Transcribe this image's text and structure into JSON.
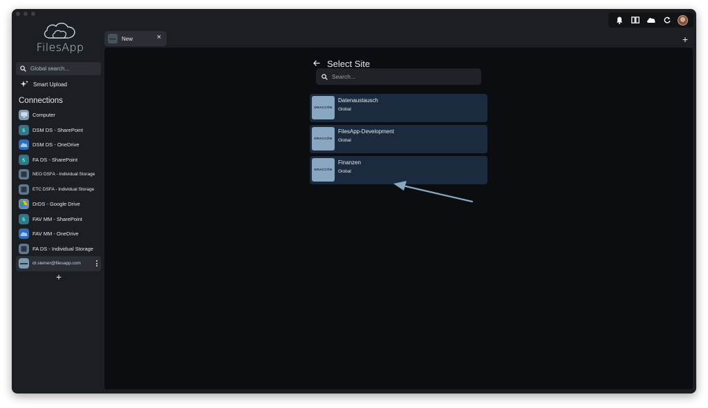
{
  "app": {
    "name": "FilesApp"
  },
  "sidebar": {
    "search_placeholder": "Global search...",
    "smart_upload_label": "Smart Upload",
    "connections_title": "Connections",
    "connections": [
      {
        "label": "Computer",
        "icon": "computer-icon"
      },
      {
        "label": "DSM DS - SharePoint",
        "icon": "sharepoint-icon"
      },
      {
        "label": "DSM DS - OneDrive",
        "icon": "onedrive-icon"
      },
      {
        "label": "FA DS - SharePoint",
        "icon": "sharepoint-icon"
      },
      {
        "label": "NEO DSFA - Individual Storage",
        "icon": "storage-icon"
      },
      {
        "label": "ETC DSFA - Individual Storage",
        "icon": "storage-icon"
      },
      {
        "label": "DrDS - Google Drive",
        "icon": "google-drive-icon"
      },
      {
        "label": "FAV MM - SharePoint",
        "icon": "sharepoint-icon"
      },
      {
        "label": "FAV MM - OneDrive",
        "icon": "onedrive-icon"
      },
      {
        "label": "FA DS - Individual Storage",
        "icon": "storage-icon"
      },
      {
        "label": "dr.steiner@filesapp.com",
        "icon": "account-icon"
      }
    ],
    "add_label": "+"
  },
  "tabs": [
    {
      "label": "New",
      "close": "×"
    }
  ],
  "new_tab_label": "+",
  "toolbar": {
    "icons": [
      "bell-icon",
      "columns-icon",
      "cloud-icon",
      "refresh-icon",
      "avatar"
    ]
  },
  "select_site": {
    "back_arrow": "←",
    "title": "Select Site",
    "search_placeholder": "Search...",
    "sites": [
      {
        "name": "Datenaustausch",
        "scope": "Global",
        "thumb": "DRACCŌN"
      },
      {
        "name": "FilesApp-Development",
        "scope": "Global",
        "thumb": "DRACCŌN"
      },
      {
        "name": "Finanzen",
        "scope": "Global",
        "thumb": "DRACCŌN"
      }
    ]
  },
  "colors": {
    "window_bg": "#1b1e22",
    "main_bg": "#0b0d10",
    "card_bg": "#1c2a3f",
    "thumb_bg": "#8aa7c1",
    "arrow": "#8aa7c1"
  }
}
